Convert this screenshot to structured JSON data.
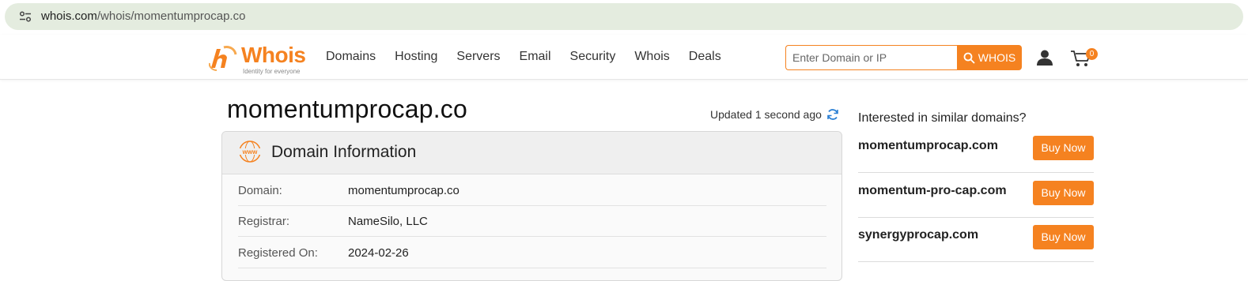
{
  "browser": {
    "url_host": "whois.com",
    "url_path": "/whois/momentumprocap.co",
    "site_info_icon": "tune-icon"
  },
  "header": {
    "logo_word": "Whois",
    "logo_tagline": "Identity for everyone",
    "nav": [
      "Domains",
      "Hosting",
      "Servers",
      "Email",
      "Security",
      "Whois",
      "Deals"
    ],
    "search_placeholder": "Enter Domain or IP",
    "search_button": "WHOIS",
    "cart_count": "0",
    "accent_color": "#f58220"
  },
  "main": {
    "domain_title": "momentumprocap.co",
    "updated_text": "Updated 1 second ago",
    "card_title": "Domain Information",
    "rows": [
      {
        "key": "Domain:",
        "value": "momentumprocap.co"
      },
      {
        "key": "Registrar:",
        "value": "NameSilo, LLC"
      },
      {
        "key": "Registered On:",
        "value": "2024-02-26"
      }
    ]
  },
  "sidebar": {
    "title": "Interested in similar domains?",
    "domains": [
      {
        "name": "momentumprocap.com",
        "button": "Buy Now"
      },
      {
        "name": "momentum-pro-cap.com",
        "button": "Buy Now"
      },
      {
        "name": "synergyprocap.com",
        "button": "Buy Now"
      }
    ]
  }
}
